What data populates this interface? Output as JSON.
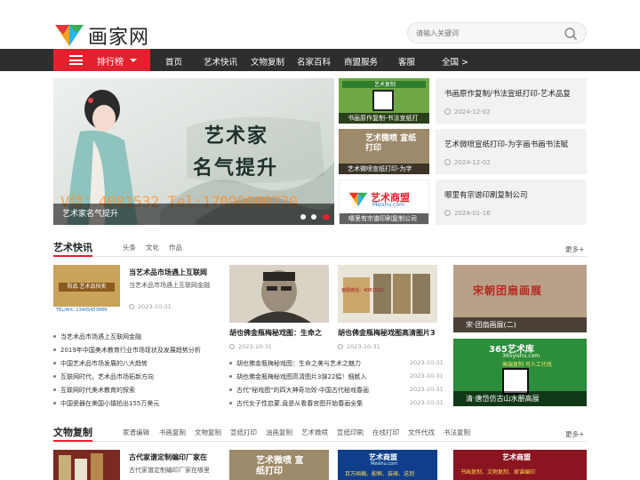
{
  "header": {
    "logo_text": "画家网",
    "search_placeholder": "请输入关键词"
  },
  "nav": {
    "rank_label": "排行榜",
    "items": [
      "首页",
      "艺术快讯",
      "文物复制",
      "名家百科",
      "商盟服务",
      "客服",
      "全国 >"
    ]
  },
  "banner": {
    "headline_1": "艺术家",
    "headline_2": "名气提升",
    "watermark": "V信：4081532  Tel:17090090770",
    "caption": "艺术家名气提升",
    "slide_count": 3,
    "active_slide": 3
  },
  "featured": [
    {
      "thumb_caption": "书画原作复制-书法宣纸打",
      "thumb_text": "艺术复制",
      "title": "书画原作复制/书法宣纸打印-艺术品复",
      "date": "2024-12-02"
    },
    {
      "thumb_caption": "艺术微喷宣纸打印-为字",
      "thumb_text": "艺术微喷 宣纸打印",
      "title": "艺术微喷宣纸打印-为字画书画书法赋",
      "date": "2024-12-02"
    },
    {
      "thumb_caption": "哪里有宗谱印刷复制公司",
      "thumb_text": "艺术商盟",
      "thumb_sub": "Meishu.com",
      "title": "哪里有宗谱印刷复制公司",
      "date": "2024-01-16"
    }
  ],
  "art_news": {
    "title": "艺术快讯",
    "tabs": [
      "头条",
      "文化",
      "作品"
    ],
    "more": "更多+",
    "lead": {
      "title": "当艺术品市场遇上互联网",
      "summary": "当艺术品市场遇上互联网金融",
      "date": "2023-10-31",
      "img_text": "阳品.艺术品拍卖",
      "img_tel": "TEL/WX: 13405453889"
    },
    "list": [
      "当艺术品市场遇上互联网金融",
      "2019年中国美术教育行业市场现状及发展趋势分析",
      "中国艺术品市场发展的八大趋势",
      "互联网时代，艺术品市场拓新方向",
      "互联网时代美术教育的探索",
      "中国瓷器在美国小镇拍出155万美元"
    ],
    "card_a": {
      "title": "胡也佛金瓶梅秘戏图：生命之",
      "date": "2023-10-31"
    },
    "card_b": {
      "title": "胡也佛金瓶梅秘戏图高清图片3",
      "date": "2023-10-31",
      "img_text": "客服微信：4081532"
    },
    "list2": [
      {
        "text": "胡也佛金瓶梅秘戏图：生命之美与艺术之魅力",
        "date": "2023-10-31"
      },
      {
        "text": "胡也佛金瓶梅秘戏图高清图片3弹22幅！细腻入",
        "date": "2023-10-31"
      },
      {
        "text": "古代\"秘戏图\"的四大神奇功效-中国古代秘戏春画",
        "date": "2023-10-31"
      },
      {
        "text": "古代女子性启蒙,竟是从看春宫图开始春画全集",
        "date": "2023-10-31"
      }
    ],
    "right_1": {
      "caption": "宋·团扇画展(二)",
      "img_text": "宋朝团扇画展"
    },
    "right_2": {
      "caption": "清·唐岱仿古山水册高展",
      "img_text": "365艺术库",
      "img_sub": "365yishu.com",
      "img_line": "高端复制  可人工代找"
    }
  },
  "relics": {
    "title": "文物复制",
    "tabs": [
      "家谱编辑",
      "书画复制",
      "文物复制",
      "宣纸打印",
      "油画复制",
      "艺术微喷",
      "宣纸印刷",
      "在线打印",
      "文件代找",
      "书法复制"
    ],
    "more": "更多+",
    "lead": {
      "title": "古代家谱定制编印厂家在",
      "summary": "古代家谱定制编印厂家在哪里"
    },
    "card_a_text": "艺术微喷 宣纸打印",
    "card_b_text": "艺术商盟",
    "card_b_sub": "Meishu.com",
    "card_b_line": "百万画稿、配框、装裱、送到",
    "card_c_text": "艺术商盟",
    "card_c_line": "书画复制、文物复制、家谱编印"
  },
  "colors": {
    "accent": "#e5202e",
    "nav_bg": "#2e2e2e"
  }
}
